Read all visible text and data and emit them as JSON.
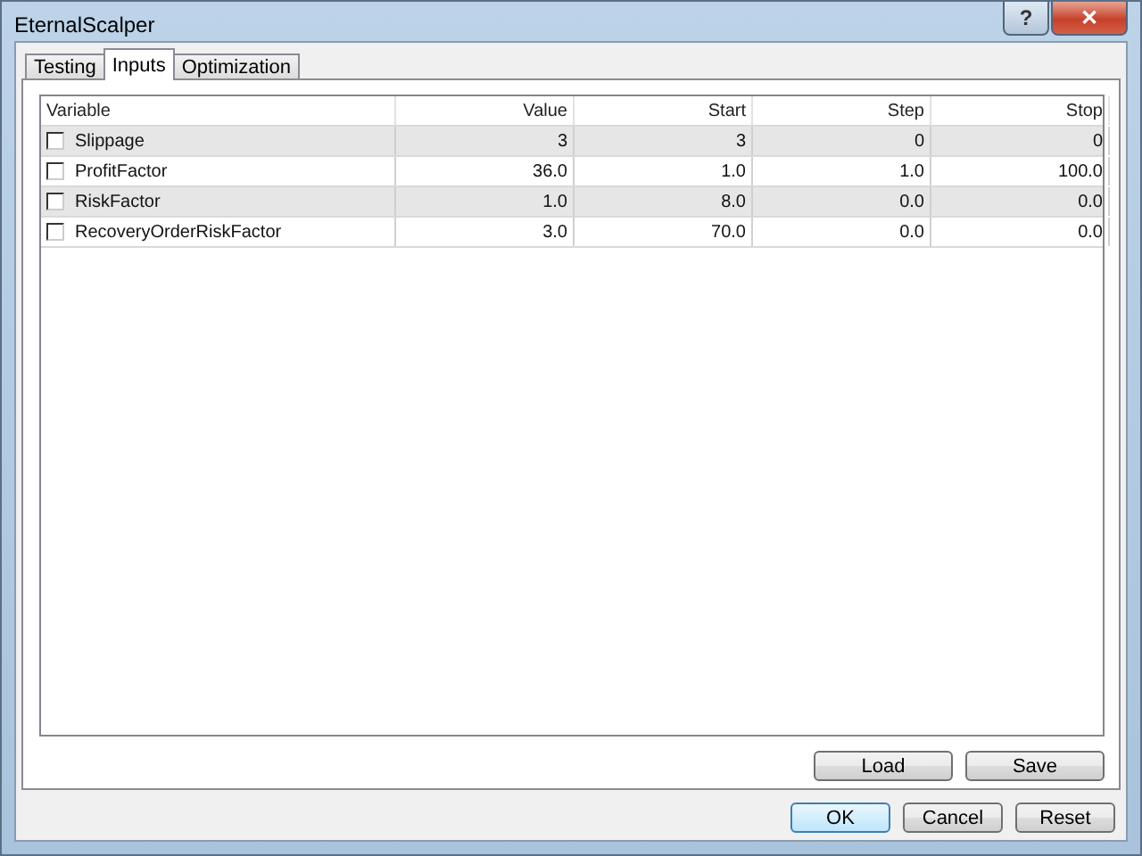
{
  "window": {
    "title": "EternalScalper",
    "help_button": "?",
    "close_button": "✕"
  },
  "tabs": [
    {
      "label": "Testing",
      "selected": false
    },
    {
      "label": "Inputs",
      "selected": true
    },
    {
      "label": "Optimization",
      "selected": false
    }
  ],
  "table": {
    "columns": [
      "Variable",
      "Value",
      "Start",
      "Step",
      "Stop"
    ],
    "rows": [
      {
        "checked": false,
        "cells": [
          "Slippage",
          "3",
          "3",
          "0",
          "0"
        ]
      },
      {
        "checked": false,
        "cells": [
          "ProfitFactor",
          "36.0",
          "1.0",
          "1.0",
          "100.0"
        ]
      },
      {
        "checked": false,
        "cells": [
          "RiskFactor",
          "1.0",
          "8.0",
          "0.0",
          "0.0"
        ]
      },
      {
        "checked": false,
        "cells": [
          "RecoveryOrderRiskFactor",
          "3.0",
          "70.0",
          "0.0",
          "0.0"
        ]
      }
    ]
  },
  "panel_buttons": [
    "Load",
    "Save"
  ],
  "dialog_buttons": [
    {
      "label": "OK",
      "default": true
    },
    {
      "label": "Cancel",
      "default": false
    },
    {
      "label": "Reset",
      "default": false
    }
  ]
}
